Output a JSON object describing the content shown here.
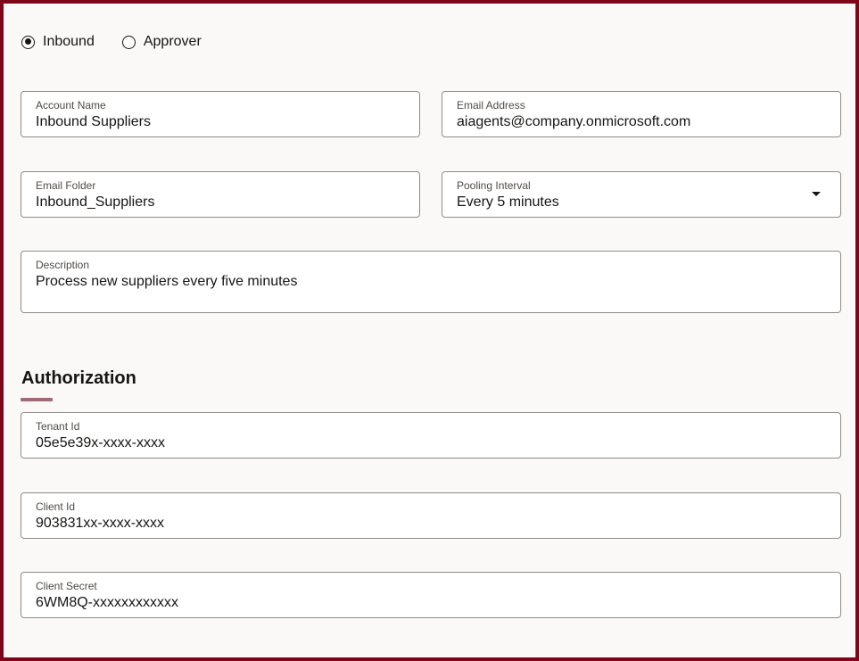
{
  "mode_options": [
    {
      "label": "Inbound",
      "selected": true
    },
    {
      "label": "Approver",
      "selected": false
    }
  ],
  "fields": {
    "account_name": {
      "label": "Account Name",
      "value": "Inbound Suppliers"
    },
    "email_address": {
      "label": "Email Address",
      "value": "aiagents@company.onmicrosoft.com"
    },
    "email_folder": {
      "label": "Email Folder",
      "value": "Inbound_Suppliers"
    },
    "pooling_interval": {
      "label": "Pooling Interval",
      "value": "Every 5 minutes"
    },
    "description": {
      "label": "Description",
      "value": "Process new suppliers every five minutes"
    }
  },
  "authorization": {
    "title": "Authorization",
    "tenant_id": {
      "label": "Tenant Id",
      "value": "05e5e39x-xxxx-xxxx"
    },
    "client_id": {
      "label": "Client Id",
      "value": "903831xx-xxxx-xxxx"
    },
    "client_secret": {
      "label": "Client Secret",
      "value": "6WM8Q-xxxxxxxxxxxx"
    }
  }
}
